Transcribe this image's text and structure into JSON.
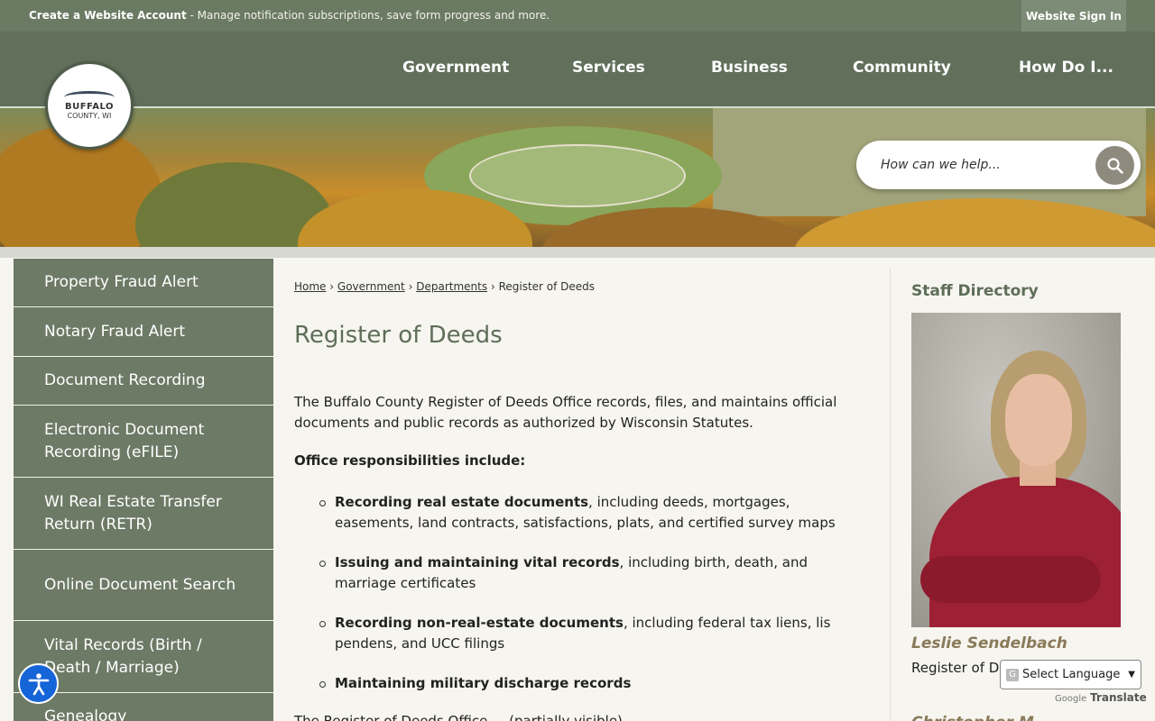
{
  "topbar": {
    "account_link": "Create a Website Account",
    "account_text": " - Manage notification subscriptions, save form progress and more.",
    "signin": "Website Sign In"
  },
  "logo": {
    "line1": "BUFFALO",
    "line2": "COUNTY, WI"
  },
  "nav": [
    "Government",
    "Services",
    "Business",
    "Community",
    "How Do I..."
  ],
  "search": {
    "placeholder": "How can we help...",
    "icon": "search-icon"
  },
  "sidebar": [
    "Property Fraud Alert",
    "Notary Fraud Alert",
    "Document Recording",
    "Electronic Document Recording (eFILE)",
    "WI Real Estate Transfer Return (RETR)",
    "Online Document Search",
    "Vital Records (Birth / Death / Marriage)",
    "Genealogy"
  ],
  "breadcrumb": {
    "home": "Home",
    "government": "Government",
    "departments": "Departments",
    "current": "Register of Deeds",
    "sep": "›"
  },
  "page_title": "Register of Deeds",
  "intro": "The Buffalo County Register of Deeds Office records, files, and maintains official documents and public records as authorized by Wisconsin Statutes.",
  "responsibilities_heading": "Office responsibilities include:",
  "responsibilities": [
    {
      "bold": "Recording real estate documents",
      "rest": ", including deeds, mortgages, easements, land contracts, satisfactions, plats, and certified survey maps"
    },
    {
      "bold": "Issuing and maintaining vital records",
      "rest": ", including birth, death, and marriage certificates"
    },
    {
      "bold": "Recording non-real-estate documents",
      "rest": ", including federal tax liens, lis pendens, and UCC filings"
    },
    {
      "bold": "Maintaining military discharge records",
      "rest": ""
    }
  ],
  "partial_paragraph": "The Register of Deeds Office ... (partially visible)",
  "staff": {
    "heading": "Staff Directory",
    "name": "Leslie Sendelbach",
    "role": "Register of Deeds",
    "next_name": "Christopher M..."
  },
  "translate": {
    "select": "Select Language",
    "powered_google": "Google",
    "powered_translate": "Translate"
  },
  "colors": {
    "green_dark": "#616f5b",
    "green_side": "#6d7a66",
    "title_green": "#5e6e58",
    "accent_blue": "#1564d8"
  }
}
